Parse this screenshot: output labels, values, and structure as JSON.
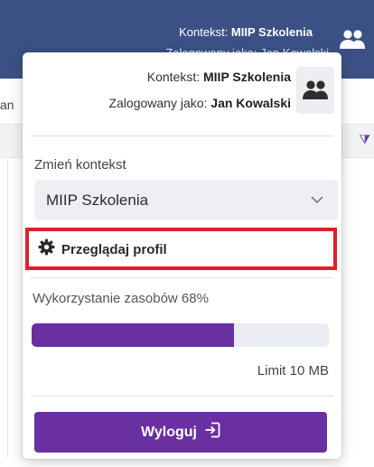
{
  "topbar": {
    "context_prefix": "Kontekst: ",
    "context_value": "MIIP Szkolenia",
    "user_text": "Zalogowany jako: Jan Kowalski",
    "avatar_icon": "users-icon",
    "background": "#3b5186"
  },
  "page_behind": {
    "left_text_fragment": "an",
    "right_glyph": "⧩"
  },
  "panel": {
    "context_prefix": "Kontekst: ",
    "context_value": "MIIP Szkolenia",
    "user_prefix": "Zalogowany jako: ",
    "user_value": "Jan Kowalski",
    "avatar_icon": "users-icon",
    "change_context_label": "Zmień kontekst",
    "select_value": "MIIP Szkolenia",
    "chevron_icon": "chevron-down-icon",
    "profile_icon": "gear-icon",
    "profile_label": "Przeglądaj profil",
    "highlight_color": "#e01e2c",
    "usage_label": "Wykorzystanie zasobów 68%",
    "usage_fraction": 0.68,
    "limit_label": "Limit 10 MB",
    "logout_label": "Wyloguj",
    "logout_icon": "logout-icon",
    "accent_color": "#6a2fa0"
  }
}
